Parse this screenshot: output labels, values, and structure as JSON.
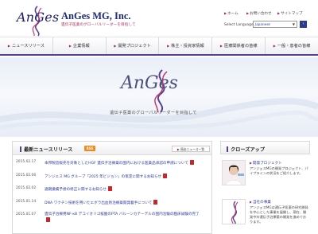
{
  "header": {
    "logo_text": "AnGes",
    "company_name": "AnGes MG, Inc.",
    "tagline": "遺伝子医薬のグローバルリーダーを目指して",
    "utility_links": [
      "ホーム",
      "お問い合わせ",
      "サイトマップ"
    ],
    "select_language_label": "Select Language",
    "language_value": "Japanese",
    "go_label": "›"
  },
  "nav": {
    "items": [
      "ニュースリリース",
      "企業情報",
      "開発プロジェクト",
      "株主・投資家情報",
      "医療関係者の皆様",
      "一般・患者の皆様"
    ]
  },
  "hero": {
    "logo_text": "AnGes",
    "tagline": "遺伝子医薬のグローバルリーダーを目指して"
  },
  "news": {
    "title": "最新ニュースリリース",
    "rss_label": "RSS",
    "all_link": "過去ニュース一覧",
    "items": [
      {
        "date": "2015.02.17",
        "text": "本邦製造販売を対象としたHGF 遺伝子治療薬の国内における医薬品承認の申請について"
      },
      {
        "date": "2015.02.06",
        "text": "アンジェス MG グループ「2025 年ビジョン」の策定に関するお知らせ"
      },
      {
        "date": "2015.02.02",
        "text": "通期業績予想の修正に関するお知らせ"
      },
      {
        "date": "2015.01.14",
        "text": "DNA ワクチン技術を用いたエボラ出血熱治療薬開発着手について"
      },
      {
        "date": "2015.01.07",
        "text": "遺伝子治療用NF-κB デコイオリゴ核酸のPTA バルーンカテーテルの国内治験の臨床試験の完了"
      }
    ]
  },
  "closeup": {
    "title": "クローズアップ",
    "items": [
      {
        "title": "開発プロジェクト",
        "text": "アンジェスMGの開発プロジェクト、パイプラインの状況をご紹介します。"
      },
      {
        "title": "当社の事業",
        "text": "アンジェスMGは遺伝子医薬の研究開発を中心とした事業を展開し、現在、開発中の遺伝子治療薬の開発を進めております。"
      }
    ]
  },
  "colors": {
    "accent_purple": "#5a3f8e",
    "accent_magenta": "#9a1e5a",
    "link_blue": "#2a3a9a",
    "rss_orange": "#f08a1c",
    "pdf_red": "#c9252c"
  }
}
